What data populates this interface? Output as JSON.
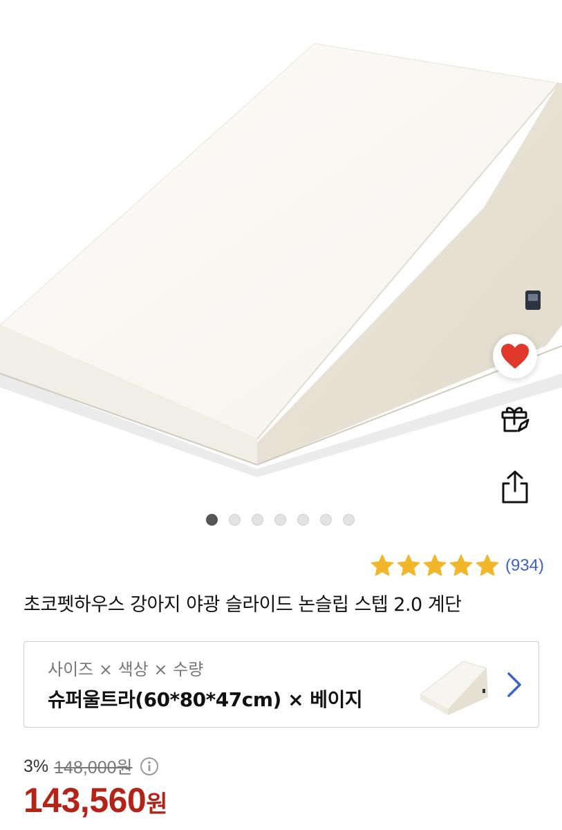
{
  "product": {
    "title": "초코펫하우스 강아지 야광 슬라이드 논슬립 스텝 2.0 계단",
    "image_count": 7,
    "active_image_index": 0
  },
  "actions": {
    "wishlist_icon": "heart-icon",
    "gift_icon": "gift-rocket-icon",
    "share_icon": "share-icon",
    "wishlisted": true
  },
  "rating": {
    "stars": 5,
    "review_count": "(934)"
  },
  "option": {
    "labels": "사이즈 × 색상 × 수량",
    "selected": "슈퍼울트라(60*80*47cm) × 베이지",
    "chevron_icon": "chevron-right-icon"
  },
  "price": {
    "discount": "3%",
    "original": "148,000원",
    "info_icon": "info-icon",
    "sale_number": "143,560",
    "sale_unit": "원"
  },
  "colors": {
    "heart": "#e0392b",
    "star": "#f2b62b",
    "review_link": "#3a62c8",
    "sale_price": "#b42318"
  }
}
